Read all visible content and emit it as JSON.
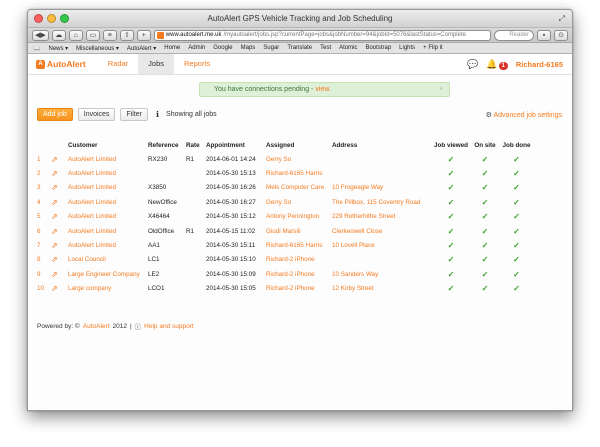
{
  "browser": {
    "window_title": "AutoAlert GPS Vehicle Tracking and Job Scheduling",
    "url_host": "www.autoalert.me.uk",
    "url_path": "/myautoalert/jobs.jsp?currentPage=jobs&jobNumber=94&jobId=5076&lastStatus=Complete",
    "search_placeholder": "Reader",
    "bookmarks": [
      "News ▾",
      "Miscellaneous ▾",
      "AutoAlert ▾",
      "Home",
      "Admin",
      "Google",
      "Maps",
      "Sugar",
      "Translate",
      "Test",
      "Atomic",
      "Bootstrap",
      "Lights",
      "+ Flip it"
    ]
  },
  "app": {
    "logo": "AutoAlert",
    "nav": [
      "Radar",
      "Jobs",
      "Reports"
    ],
    "active_nav": "Jobs",
    "notification_count": "1",
    "user": "Richard-6165"
  },
  "alert": {
    "text": "You have connections pending - ",
    "link": "view.",
    "close": "×"
  },
  "actions": {
    "add_job": "Add job",
    "invoices": "Invoices",
    "filter": "Filter",
    "info": "ℹ",
    "showing": "Showing all jobs",
    "advanced": "Advanced job settings"
  },
  "table": {
    "headers": [
      "Customer",
      "Reference",
      "Rate",
      "Appointment",
      "Assigned",
      "Address",
      "Job viewed",
      "On site",
      "Job done"
    ],
    "rows": [
      {
        "n": "1",
        "customer": "AutoAlert Limited",
        "ref": "RX230",
        "rate": "R1",
        "appt": "2014-06-01 14:24",
        "assigned": "Gerry So",
        "address": "",
        "viewed": "✓",
        "onsite": "✓",
        "done": "✓"
      },
      {
        "n": "2",
        "customer": "AutoAlert Limited",
        "ref": "",
        "rate": "",
        "appt": "2014-05-30 15:13",
        "assigned": "Richard-6165 Harris",
        "address": "",
        "viewed": "✓",
        "onsite": "✓",
        "done": "✓"
      },
      {
        "n": "3",
        "customer": "AutoAlert Limited",
        "ref": "X3850",
        "rate": "",
        "appt": "2014-05-30 16:26",
        "assigned": "Mels Computer Care",
        "address": "10 Frogeagle Way",
        "viewed": "✓",
        "onsite": "✓",
        "done": "✓"
      },
      {
        "n": "4",
        "customer": "AutoAlert Limited",
        "ref": "NewOffice",
        "rate": "",
        "appt": "2014-05-30 16:27",
        "assigned": "Gerry So",
        "address": "The Pillbox, 115 Coventry Road",
        "viewed": "✓",
        "onsite": "✓",
        "done": "✓"
      },
      {
        "n": "5",
        "customer": "AutoAlert Limited",
        "ref": "X46464",
        "rate": "",
        "appt": "2014-05-30 15:12",
        "assigned": "Antony Pennington",
        "address": "229 Rotherhithe Street",
        "viewed": "✓",
        "onsite": "✓",
        "done": "✓"
      },
      {
        "n": "6",
        "customer": "AutoAlert Limited",
        "ref": "OldOffice",
        "rate": "R1",
        "appt": "2014-05-15 11:02",
        "assigned": "Giudi Marsili",
        "address": "Clerkenwell Close",
        "viewed": "✓",
        "onsite": "✓",
        "done": "✓"
      },
      {
        "n": "7",
        "customer": "AutoAlert Limited",
        "ref": "AA1",
        "rate": "",
        "appt": "2014-05-30 15:11",
        "assigned": "Richard-6165 Harris",
        "address": "10 Lovell Place",
        "viewed": "✓",
        "onsite": "✓",
        "done": "✓"
      },
      {
        "n": "8",
        "customer": "Local Council",
        "ref": "LC1",
        "rate": "",
        "appt": "2014-05-30 15:10",
        "assigned": "Richard-2 iPhone",
        "address": "",
        "viewed": "✓",
        "onsite": "✓",
        "done": "✓"
      },
      {
        "n": "9",
        "customer": "Large Engineer Company",
        "ref": "LE2",
        "rate": "",
        "appt": "2014-05-30 15:09",
        "assigned": "Richard-2 iPhone",
        "address": "10 Sanders Way",
        "viewed": "✓",
        "onsite": "✓",
        "done": "✓"
      },
      {
        "n": "10",
        "customer": "Large company",
        "ref": "LCO1",
        "rate": "",
        "appt": "2014-05-30 15:05",
        "assigned": "Richard-2 iPhone",
        "address": "12 Kirby Street",
        "viewed": "✓",
        "onsite": "✓",
        "done": "✓"
      }
    ]
  },
  "footer": {
    "powered": "Powered by: ©",
    "brand": "AutoAlert",
    "year": "2012",
    "sep": "|",
    "help": "Help and support"
  },
  "colors": {
    "accent": "#f47b20",
    "check": "#3aa02b",
    "alert_bg": "#dff0d8"
  }
}
